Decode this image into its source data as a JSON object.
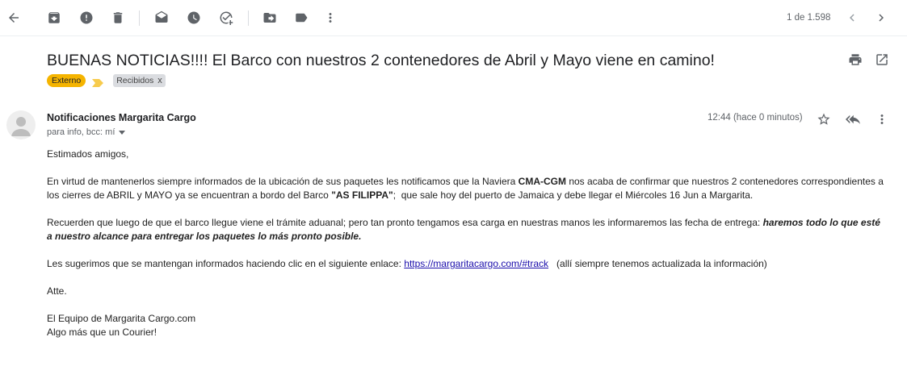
{
  "toolbar": {
    "pager_text": "1 de 1.598"
  },
  "message": {
    "subject": "BUENAS NOTICIAS!!!! El Barco con nuestros 2 contenedores de Abril y Mayo viene en camino!",
    "labels": {
      "externo": "Externo",
      "recibidos": "Recibidos",
      "remove": "x"
    },
    "sender": "Notificaciones Margarita Cargo",
    "recipients": "para info, bcc: mí",
    "time": "12:44 (hace 0 minutos)",
    "body": {
      "greeting": "Estimados amigos,",
      "p1_a": "En virtud de mantenerlos siempre informados de la ubicación de sus paquetes les notificamos que la Naviera ",
      "p1_bold1": "CMA-CGM",
      "p1_b": " nos acaba de confirmar que nuestros 2 contenedores correspondientes a los cierres de ABRIL y MAYO ya se encuentran a bordo del Barco ",
      "p1_bold2": "\"AS FILIPPA\"",
      "p1_c": ";  que sale hoy del puerto de Jamaica y debe llegar el Miércoles 16 Jun a Margarita.",
      "p2_a": "Recuerden que luego de que el barco llegue viene el trámite aduanal; pero tan pronto tengamos esa carga en nuestras manos les informaremos las fecha de entrega: ",
      "p2_bolditalic": "haremos todo lo que esté a nuestro alcance para entregar los paquetes lo más pronto posible.",
      "p3_a": "Les sugerimos que se mantengan informados haciendo clic en el siguiente enlace: ",
      "p3_link": "https://margaritacargo.com/#track",
      "p3_b": "   (allí siempre tenemos actualizada la información)",
      "closing": "Atte.",
      "sig1": "El Equipo de Margarita Cargo.com",
      "sig2": "Algo más que un Courier!"
    }
  },
  "icons": [
    "back-icon",
    "archive-icon",
    "report-spam-icon",
    "delete-icon",
    "mark-unread-icon",
    "snooze-icon",
    "add-task-icon",
    "move-to-icon",
    "label-icon",
    "more-icon",
    "prev-icon",
    "next-icon",
    "print-icon",
    "open-new-window-icon",
    "star-icon",
    "reply-all-icon",
    "more-vert-icon"
  ],
  "colors": {
    "externo_label": "#f5b400",
    "importance_marker": "#f7cb4d",
    "link": "#1a0dab"
  }
}
